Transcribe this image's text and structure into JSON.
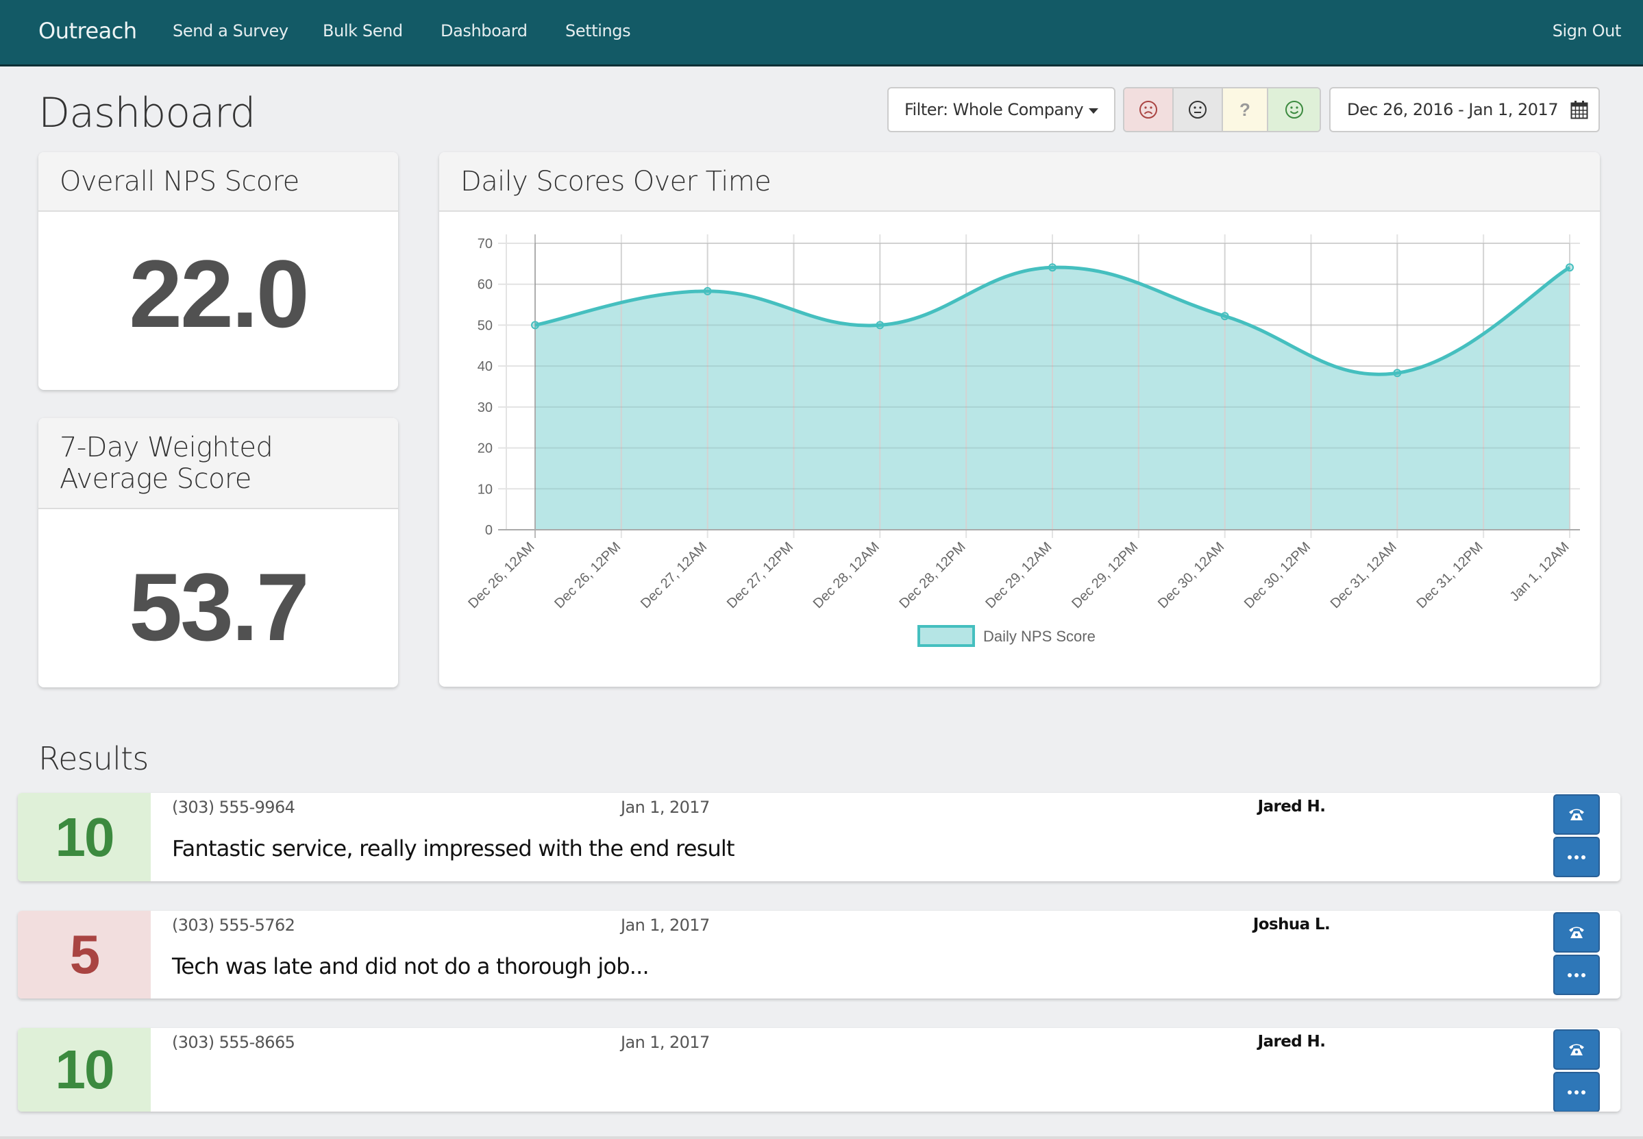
{
  "navbar": {
    "brand": "Outreach",
    "items": [
      {
        "label": "Send a Survey"
      },
      {
        "label": "Bulk Send"
      },
      {
        "label": "Dashboard"
      },
      {
        "label": "Settings"
      }
    ],
    "sign_out": "Sign Out",
    "background": "#135a66"
  },
  "page": {
    "title": "Dashboard"
  },
  "toolbar": {
    "filter_label": "Filter: Whole Company",
    "sentiment_filters": [
      {
        "name": "negative",
        "icon": "frown-icon",
        "color": "#a94442",
        "background": "#f2dede"
      },
      {
        "name": "neutral",
        "icon": "neutral-face-icon",
        "color": "#333333",
        "background": "#e6e6e6"
      },
      {
        "name": "unknown",
        "icon": "question-icon",
        "glyph": "?",
        "color": "#999999",
        "background": "#fcf8e3"
      },
      {
        "name": "positive",
        "icon": "smile-icon",
        "color": "#3c8a3f",
        "background": "#dff0d8"
      }
    ],
    "date_range": "Dec 26, 2016 - Jan 1, 2017",
    "date_icon": "calendar-icon"
  },
  "stats": {
    "overall_nps": {
      "title": "Overall NPS Score",
      "value": "22.0"
    },
    "weighted_avg": {
      "title_line1": "7-Day Weighted",
      "title_line2": "Average Score",
      "value": "53.7"
    }
  },
  "chart_card": {
    "title": "Daily Scores Over Time"
  },
  "chart_data": {
    "type": "area",
    "title": "Daily Scores Over Time",
    "xlabel": "",
    "ylabel": "",
    "x_tick_labels": [
      "Dec 26, 12AM",
      "Dec 26, 12PM",
      "Dec 27, 12AM",
      "Dec 27, 12PM",
      "Dec 28, 12AM",
      "Dec 28, 12PM",
      "Dec 29, 12AM",
      "Dec 29, 12PM",
      "Dec 30, 12AM",
      "Dec 30, 12PM",
      "Dec 31, 12AM",
      "Dec 31, 12PM",
      "Jan 1, 12AM"
    ],
    "x": [
      "Dec 26, 12AM",
      "Dec 27, 12AM",
      "Dec 28, 12AM",
      "Dec 29, 12AM",
      "Dec 30, 12AM",
      "Dec 31, 12AM",
      "Jan 1, 12AM"
    ],
    "x_tick_index": [
      0,
      2,
      4,
      6,
      8,
      10,
      12
    ],
    "series": [
      {
        "name": "Daily NPS Score",
        "values": [
          50.0,
          58.3,
          50.0,
          64.1,
          52.2,
          38.3,
          64.1
        ],
        "color": "#45bfbf",
        "fill": "#b5e5e5"
      }
    ],
    "y_ticks": [
      0,
      10,
      20,
      30,
      40,
      50,
      60,
      70
    ],
    "ylim": [
      0,
      70
    ],
    "grid": true,
    "legend": "bottom-center",
    "smooth": true
  },
  "results": {
    "title": "Results",
    "rows": [
      {
        "score": "10",
        "sentiment": "good",
        "phone": "(303) 555-9964",
        "date": "Jan 1, 2017",
        "agent": "Jared H.",
        "comment": "Fantastic service, really impressed with the end result"
      },
      {
        "score": "5",
        "sentiment": "bad",
        "phone": "(303) 555-5762",
        "date": "Jan 1, 2017",
        "agent": "Joshua L.",
        "comment": "Tech was late and did not do a thorough job..."
      },
      {
        "score": "10",
        "sentiment": "good",
        "phone": "(303) 555-8665",
        "date": "Jan 1, 2017",
        "agent": "Jared H.",
        "comment": ""
      }
    ],
    "call_icon": "phone-icon",
    "more_icon": "more-dots-icon"
  }
}
